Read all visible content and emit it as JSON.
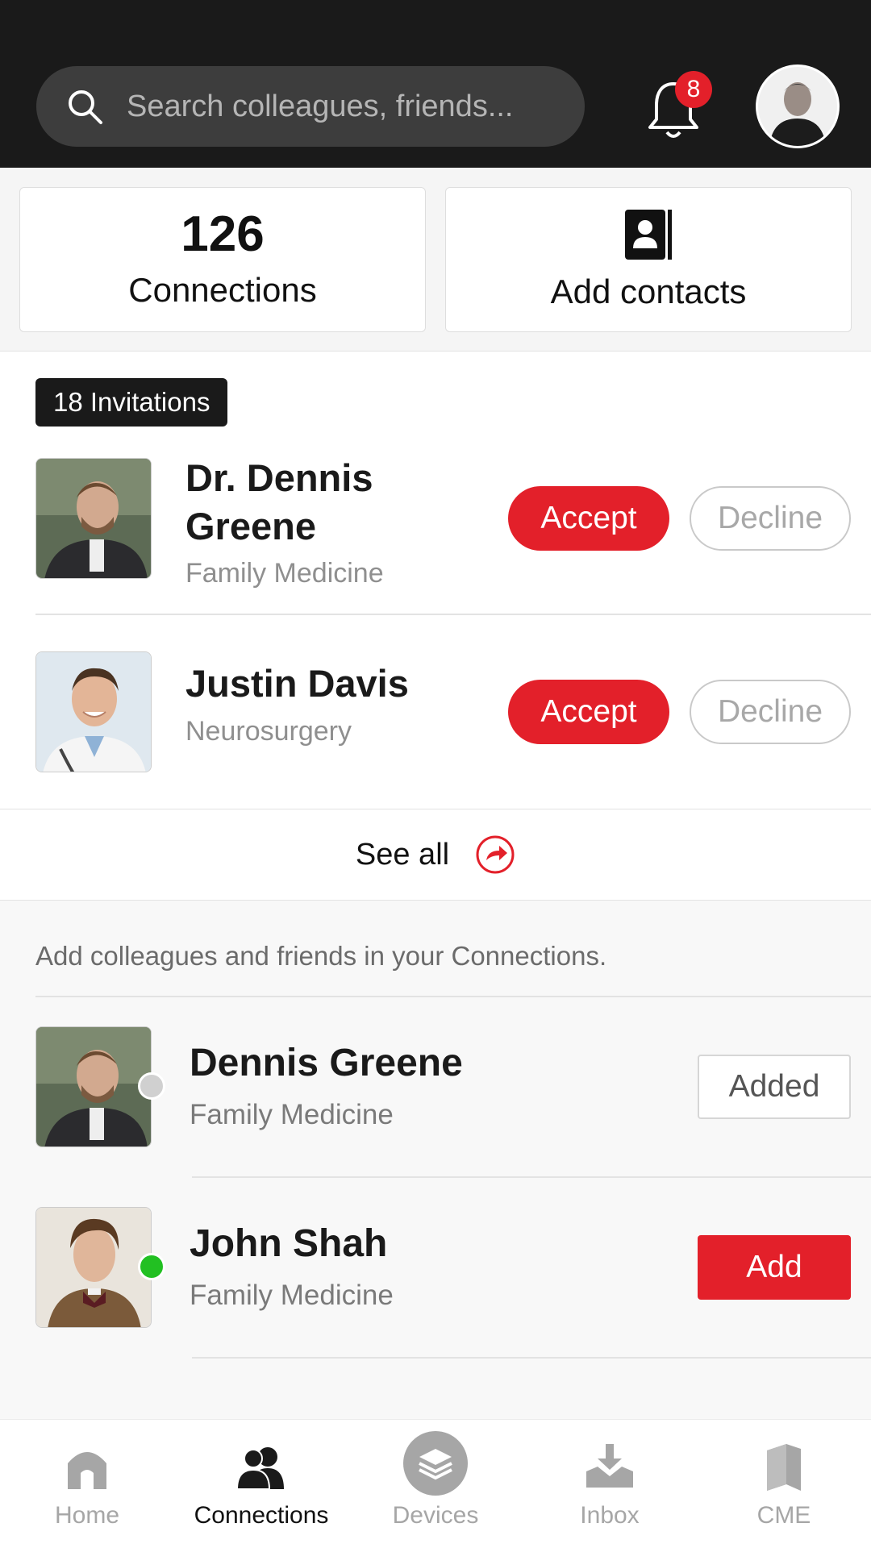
{
  "header": {
    "search_placeholder": "Search colleagues, friends...",
    "notification_count": "8"
  },
  "stats": {
    "connections_count": "126",
    "connections_label": "Connections",
    "add_contacts_label": "Add contacts"
  },
  "invitations": {
    "badge": "18 Invitations",
    "items": [
      {
        "name_line1": "Dr. Dennis",
        "name_line2": "Greene",
        "specialty": "Family Medicine",
        "accept": "Accept",
        "decline": "Decline"
      },
      {
        "name_line1": "Justin Davis",
        "specialty": "Neurosurgery",
        "accept": "Accept",
        "decline": "Decline"
      }
    ],
    "see_all": "See all"
  },
  "suggestions": {
    "prompt": "Add colleagues and friends in your Connections.",
    "items": [
      {
        "name": "Dennis Greene",
        "specialty": "Family Medicine",
        "status": "offline",
        "action": "Added"
      },
      {
        "name": "John Shah",
        "specialty": "Family Medicine",
        "status": "online",
        "action": "Add"
      }
    ]
  },
  "colors": {
    "accent": "#e3202a",
    "online": "#22c022",
    "offline": "#d0d0d0"
  },
  "tabs": [
    {
      "label": "Home",
      "icon": "home-icon",
      "active": false
    },
    {
      "label": "Connections",
      "icon": "connections-icon",
      "active": true
    },
    {
      "label": "Devices",
      "icon": "devices-icon",
      "active": false
    },
    {
      "label": "Inbox",
      "icon": "inbox-icon",
      "active": false
    },
    {
      "label": "CME",
      "icon": "cme-icon",
      "active": false
    }
  ]
}
